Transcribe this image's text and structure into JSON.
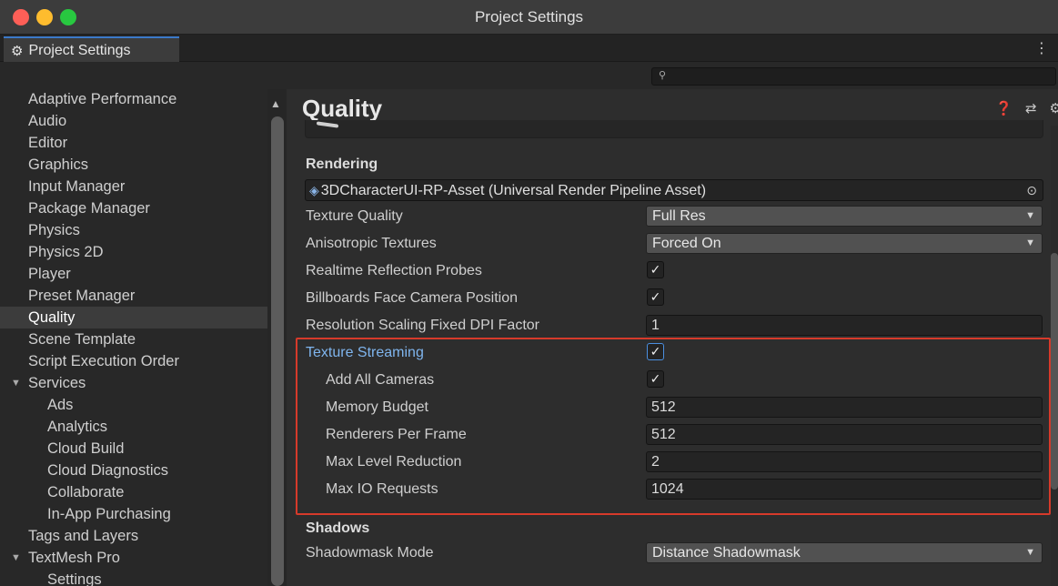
{
  "window": {
    "title": "Project Settings"
  },
  "tab": {
    "label": "Project Settings",
    "menu_glyph": "⋮"
  },
  "search": {
    "placeholder": ""
  },
  "sidebar": {
    "items": [
      {
        "label": "Adaptive Performance",
        "indent": 0
      },
      {
        "label": "Audio",
        "indent": 0
      },
      {
        "label": "Editor",
        "indent": 0
      },
      {
        "label": "Graphics",
        "indent": 0
      },
      {
        "label": "Input Manager",
        "indent": 0
      },
      {
        "label": "Package Manager",
        "indent": 0
      },
      {
        "label": "Physics",
        "indent": 0
      },
      {
        "label": "Physics 2D",
        "indent": 0
      },
      {
        "label": "Player",
        "indent": 0
      },
      {
        "label": "Preset Manager",
        "indent": 0
      },
      {
        "label": "Quality",
        "indent": 0,
        "selected": true
      },
      {
        "label": "Scene Template",
        "indent": 0
      },
      {
        "label": "Script Execution Order",
        "indent": 0
      },
      {
        "label": "Services",
        "indent": 0,
        "expanded": true
      },
      {
        "label": "Ads",
        "indent": 1
      },
      {
        "label": "Analytics",
        "indent": 1
      },
      {
        "label": "Cloud Build",
        "indent": 1
      },
      {
        "label": "Cloud Diagnostics",
        "indent": 1
      },
      {
        "label": "Collaborate",
        "indent": 1
      },
      {
        "label": "In-App Purchasing",
        "indent": 1
      },
      {
        "label": "Tags and Layers",
        "indent": 0
      },
      {
        "label": "TextMesh Pro",
        "indent": 0,
        "expanded": true
      },
      {
        "label": "Settings",
        "indent": 1
      }
    ]
  },
  "main": {
    "title": "Quality",
    "rendering": {
      "section": "Rendering",
      "asset": "3DCharacterUI-RP-Asset (Universal Render Pipeline Asset)",
      "texture_quality": {
        "label": "Texture Quality",
        "value": "Full Res"
      },
      "anisotropic": {
        "label": "Anisotropic Textures",
        "value": "Forced On"
      },
      "realtime_probes": {
        "label": "Realtime Reflection Probes",
        "checked": true
      },
      "billboards": {
        "label": "Billboards Face Camera Position",
        "checked": true
      },
      "dpi_factor": {
        "label": "Resolution Scaling Fixed DPI Factor",
        "value": "1"
      },
      "texture_streaming": {
        "label": "Texture Streaming",
        "checked": true
      },
      "add_all_cameras": {
        "label": "Add All Cameras",
        "checked": true
      },
      "memory_budget": {
        "label": "Memory Budget",
        "value": "512"
      },
      "renderers_per_frame": {
        "label": "Renderers Per Frame",
        "value": "512"
      },
      "max_level_reduction": {
        "label": "Max Level Reduction",
        "value": "2"
      },
      "max_io_requests": {
        "label": "Max IO Requests",
        "value": "1024"
      }
    },
    "shadows": {
      "section": "Shadows",
      "shadowmask_mode": {
        "label": "Shadowmask Mode",
        "value": "Distance Shadowmask"
      }
    }
  },
  "colors": {
    "accent": "#3b79c8",
    "highlight_box": "#d63a2a",
    "link_label": "#7fb5ee"
  }
}
